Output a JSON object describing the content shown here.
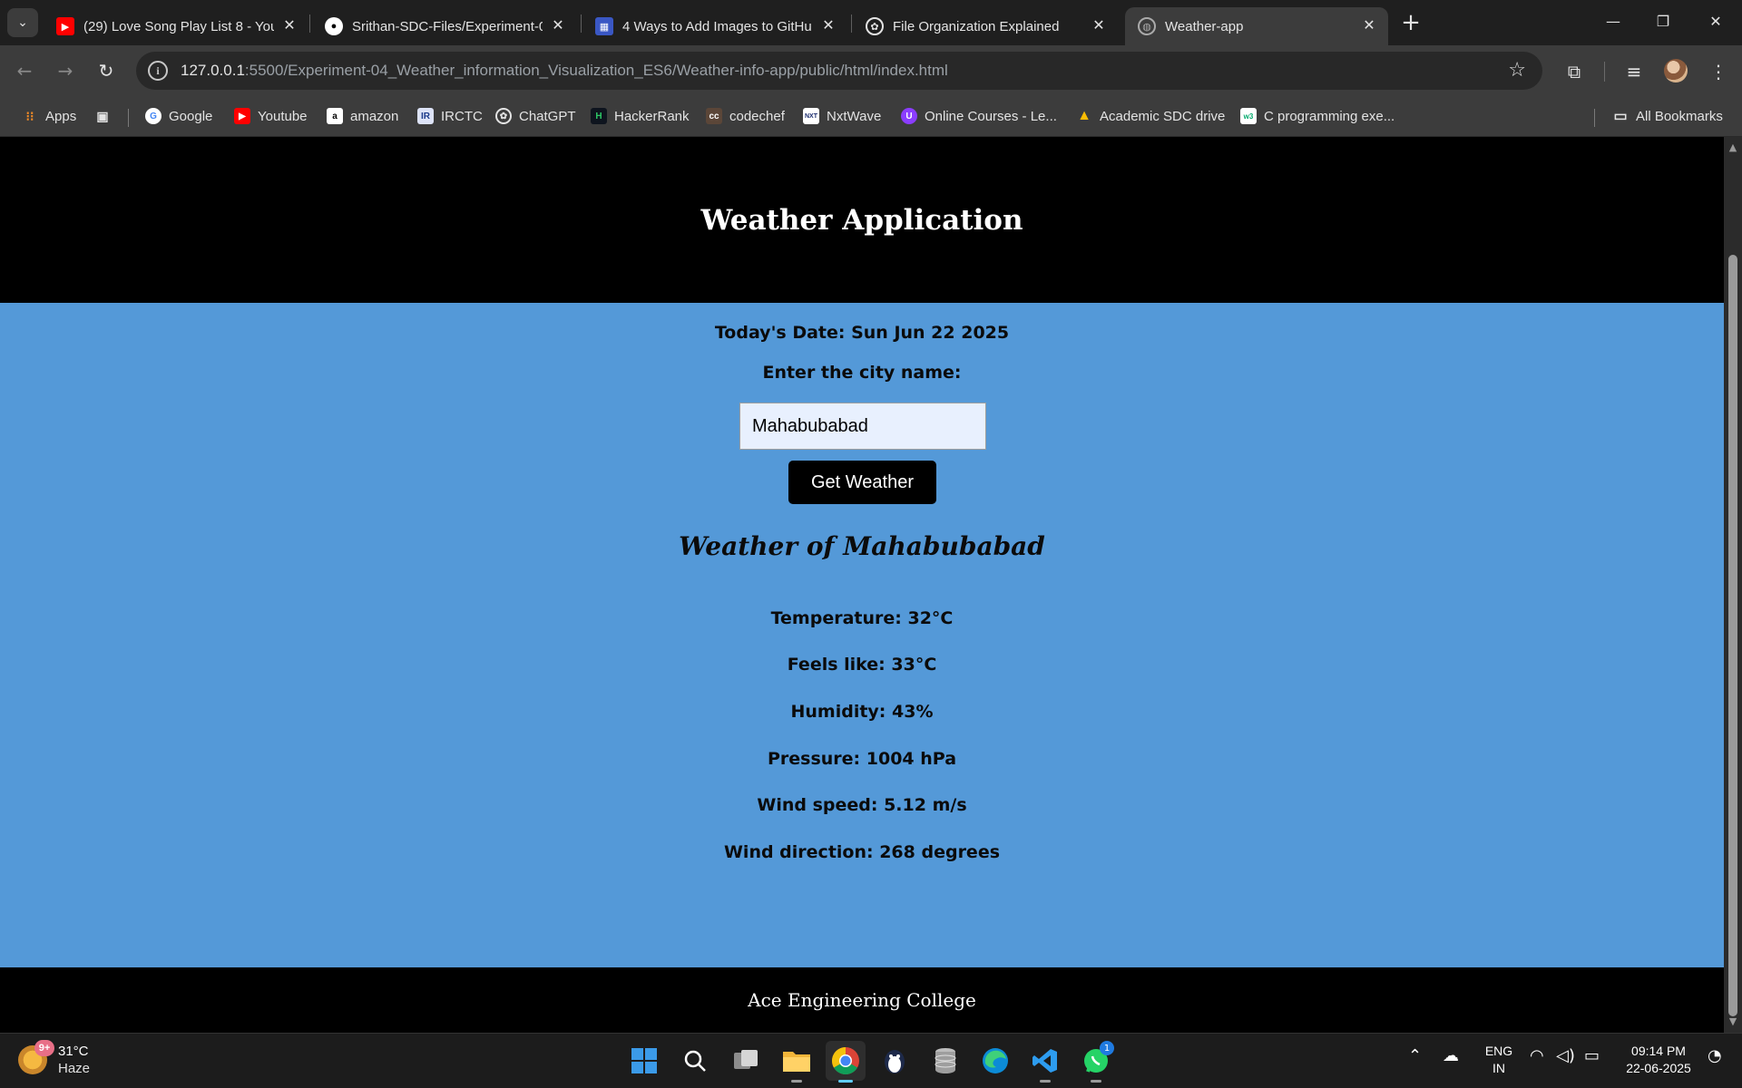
{
  "browser": {
    "tabs": [
      {
        "title": "(29) Love Song Play List 8 - You",
        "favicon": "youtube-icon"
      },
      {
        "title": "Srithan-SDC-Files/Experiment-0",
        "favicon": "github-icon"
      },
      {
        "title": "4 Ways to Add Images to GitHu",
        "favicon": "article-icon"
      },
      {
        "title": "File Organization Explained",
        "favicon": "openai-icon"
      },
      {
        "title": "Weather-app",
        "favicon": "globe-icon"
      }
    ],
    "address": {
      "host": "127.0.0.1",
      "rest": ":5500/Experiment-04_Weather_information_Visualization_ES6/Weather-info-app/public/html/index.html"
    },
    "bookmarks": [
      "Apps",
      "Google",
      "Youtube",
      "amazon",
      "IRCTC",
      "ChatGPT",
      "HackerRank",
      "codechef",
      "NxtWave",
      "Online Courses - Le...",
      "Academic SDC drive",
      "C programming exe..."
    ],
    "all_bookmarks": "All Bookmarks"
  },
  "page": {
    "header_title": "Weather Application",
    "date_text": "Today's Date: Sun Jun 22 2025",
    "city_label": "Enter the city name:",
    "city_value": "Mahabubabad",
    "button_label": "Get Weather",
    "weather_heading": "Weather of Mahabubabad",
    "stats": [
      "Temperature: 32°C",
      "Feels like: 33°C",
      "Humidity: 43%",
      "Pressure: 1004 hPa",
      "Wind speed: 5.12 m/s",
      "Wind direction: 268 degrees"
    ],
    "footer_text": "Ace Engineering College"
  },
  "taskbar": {
    "weather_temp": "31°C",
    "weather_cond": "Haze",
    "weather_badge": "9+",
    "lang_top": "ENG",
    "lang_bottom": "IN",
    "time": "09:14 PM",
    "date": "22-06-2025",
    "whatsapp_badge": "1"
  },
  "colors": {
    "page_bg": "#5499d8",
    "header_bg": "#000000",
    "input_bg": "#e8f0fe",
    "button_bg": "#000000"
  }
}
